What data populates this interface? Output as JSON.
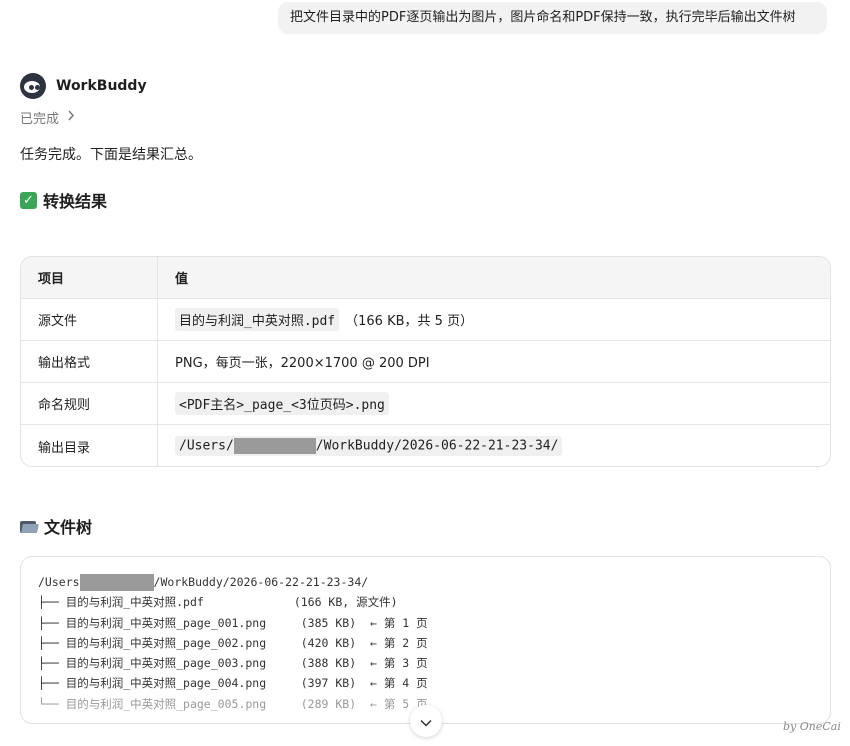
{
  "user_message": "把文件目录中的PDF逐页输出为图片，图片命名和PDF保持一致，执行完毕后输出文件树",
  "agent": {
    "name": "WorkBuddy",
    "status": "已完成"
  },
  "summary": "任务完成。下面是结果汇总。",
  "result_section": {
    "icon": "check-mark-icon",
    "title": "转换结果",
    "headers": [
      "项目",
      "值"
    ],
    "rows": [
      {
        "key": "源文件",
        "code": "目的与利润_中英对照.pdf",
        "extra": "（166 KB，共 5 页）"
      },
      {
        "key": "输出格式",
        "text": "PNG，每页一张，2200×1700 @ 200 DPI"
      },
      {
        "key": "命名规则",
        "code": "<PDF主名>_page_<3位页码>.png"
      },
      {
        "key": "输出目录",
        "code_prefix": "/Users/",
        "code_suffix": "/WorkBuddy/2026-06-22-21-23-34/"
      }
    ]
  },
  "tree_section": {
    "icon": "folder-icon",
    "title": "文件树",
    "root_prefix": "/Users",
    "root_suffix": "/WorkBuddy/2026-06-22-21-23-34/",
    "lines": [
      "├── 目的与利润_中英对照.pdf             (166 KB, 源文件)",
      "├── 目的与利润_中英对照_page_001.png     (385 KB)  ← 第 1 页",
      "├── 目的与利润_中英对照_page_002.png     (420 KB)  ← 第 2 页",
      "├── 目的与利润_中英对照_page_003.png     (388 KB)  ← 第 3 页",
      "├── 目的与利润_中英对照_page_004.png     (397 KB)  ← 第 4 页",
      "└── 目的与利润_中英对照_page_005.png     (289 KB)  ← 第 5 页"
    ]
  },
  "watermark": "by OneCai"
}
